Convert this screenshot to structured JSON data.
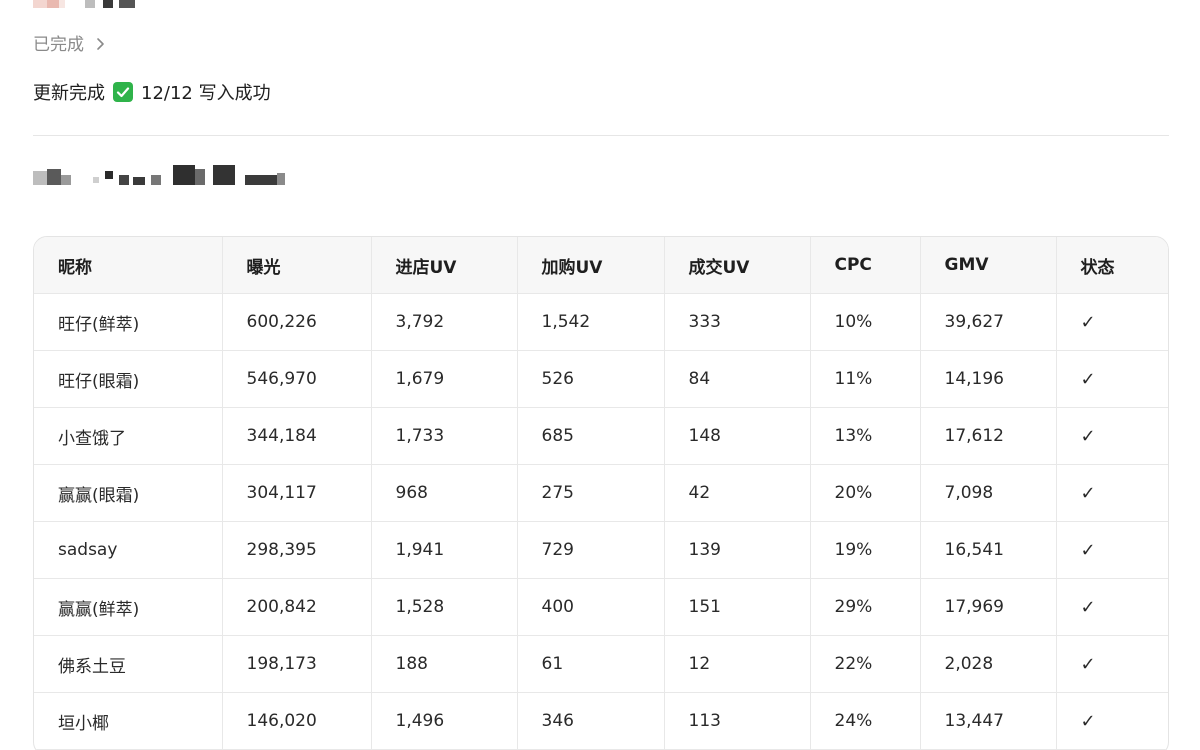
{
  "status": {
    "label": "已完成",
    "icon": "chevron-right-icon"
  },
  "update": {
    "prefix": "更新完成",
    "icon": "check-box-icon",
    "icon_color": "#2fb34a",
    "result": "12/12 写入成功"
  },
  "table": {
    "columns": [
      "昵称",
      "曝光",
      "进店UV",
      "加购UV",
      "成交UV",
      "CPC",
      "GMV",
      "状态"
    ],
    "rows": [
      [
        "旺仔(鲜萃)",
        "600,226",
        "3,792",
        "1,542",
        "333",
        "10%",
        "39,627",
        "✓"
      ],
      [
        "旺仔(眼霜)",
        "546,970",
        "1,679",
        "526",
        "84",
        "11%",
        "14,196",
        "✓"
      ],
      [
        "小查饿了",
        "344,184",
        "1,733",
        "685",
        "148",
        "13%",
        "17,612",
        "✓"
      ],
      [
        "赢赢(眼霜)",
        "304,117",
        "968",
        "275",
        "42",
        "20%",
        "7,098",
        "✓"
      ],
      [
        "sadsay",
        "298,395",
        "1,941",
        "729",
        "139",
        "19%",
        "16,541",
        "✓"
      ],
      [
        "赢赢(鲜萃)",
        "200,842",
        "1,528",
        "400",
        "151",
        "29%",
        "17,969",
        "✓"
      ],
      [
        "佛系土豆",
        "198,173",
        "188",
        "61",
        "12",
        "22%",
        "2,028",
        "✓"
      ],
      [
        "垣小椰",
        "146,020",
        "1,496",
        "346",
        "113",
        "24%",
        "13,447",
        "✓"
      ]
    ]
  }
}
